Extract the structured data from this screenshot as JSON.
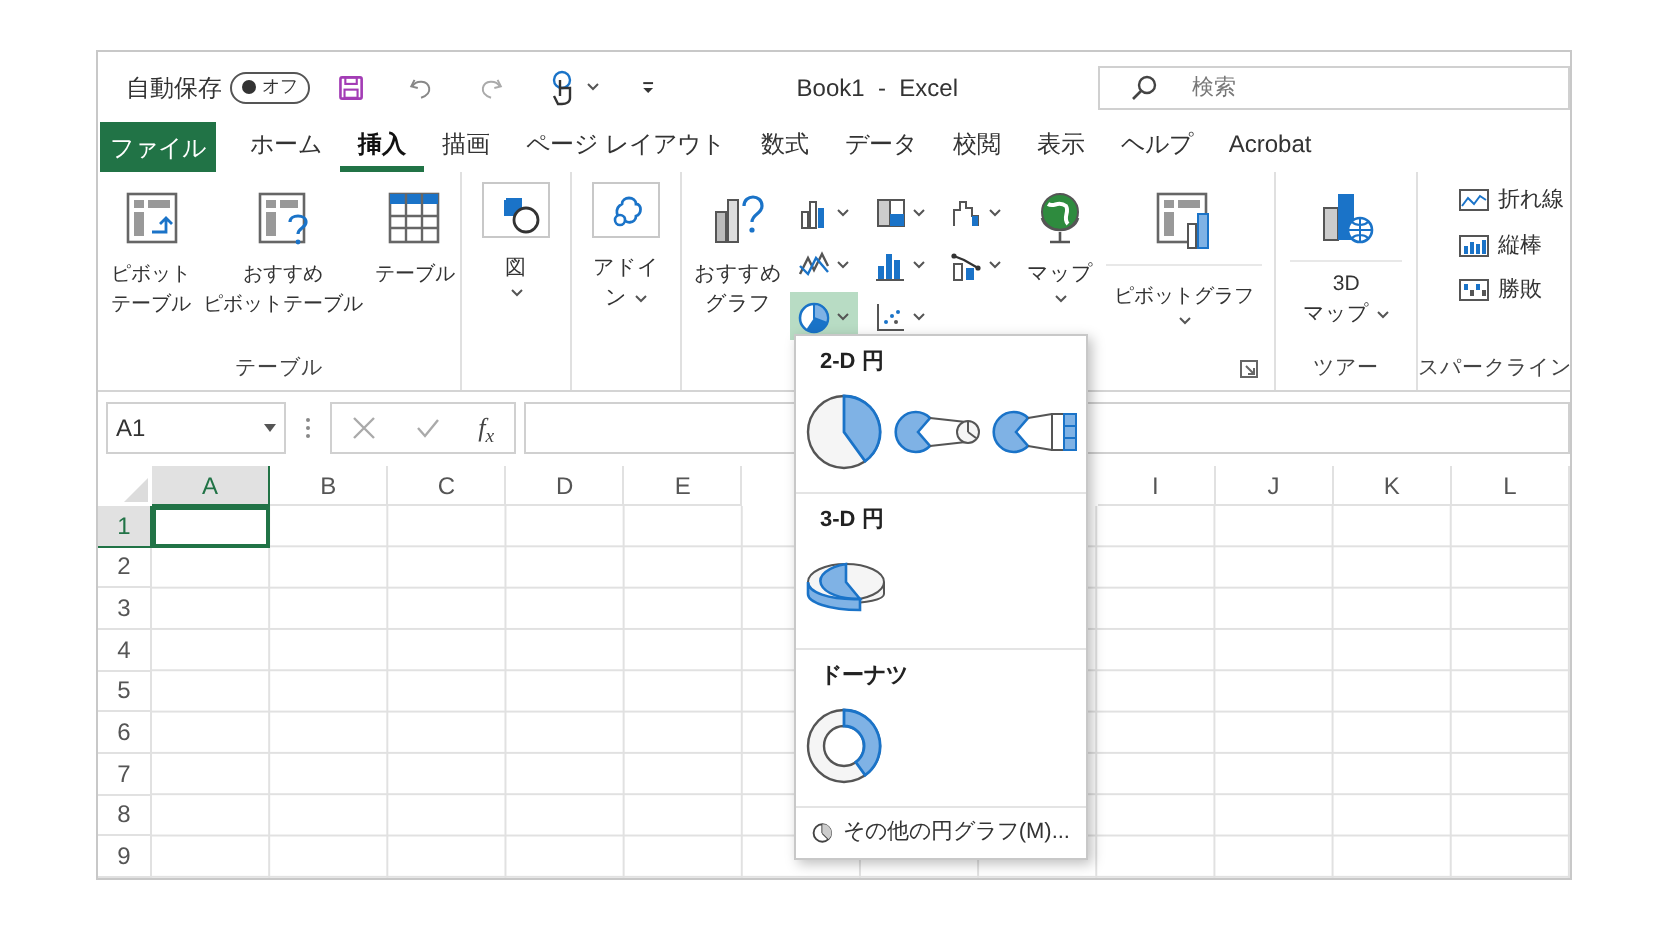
{
  "title_bar": {
    "autosave_label": "自動保存",
    "autosave": {
      "label": "オフ",
      "on": false
    },
    "title": "Book1  -  Excel",
    "search": {
      "placeholder": "検索"
    }
  },
  "tabs": [
    {
      "label": "ファイル",
      "kind": "file",
      "selected": false
    },
    {
      "label": "ホーム",
      "kind": "tab",
      "selected": false
    },
    {
      "label": "挿入",
      "kind": "tab",
      "selected": true
    },
    {
      "label": "描画",
      "kind": "tab",
      "selected": false
    },
    {
      "label": "ページ レイアウト",
      "kind": "tab",
      "selected": false
    },
    {
      "label": "数式",
      "kind": "tab",
      "selected": false
    },
    {
      "label": "データ",
      "kind": "tab",
      "selected": false
    },
    {
      "label": "校閲",
      "kind": "tab",
      "selected": false
    },
    {
      "label": "表示",
      "kind": "tab",
      "selected": false
    },
    {
      "label": "ヘルプ",
      "kind": "tab",
      "selected": false
    },
    {
      "label": "Acrobat",
      "kind": "tab",
      "selected": false
    }
  ],
  "ribbon": {
    "table_group": {
      "label": "テーブル",
      "buttons": [
        {
          "lines": [
            "ピボット",
            "テーブル"
          ]
        },
        {
          "lines": [
            "おすすめ",
            "ピボットテーブル"
          ]
        },
        {
          "lines": [
            "テーブル"
          ]
        }
      ]
    },
    "boxed_buttons": [
      {
        "lines": [
          "図"
        ],
        "has_menu": true
      },
      {
        "lines": [
          "アドイ",
          "ン"
        ],
        "has_menu": true
      }
    ],
    "charts_group": {
      "recommended": {
        "lines": [
          "おすすめ",
          "グラフ"
        ]
      },
      "chart_buttons": [
        {
          "selected": false
        },
        {
          "selected": false
        },
        {
          "selected": false
        },
        {
          "selected": false
        },
        {
          "selected": false
        },
        {
          "selected": false
        },
        {
          "selected": true
        },
        {
          "selected": false
        }
      ],
      "map": {
        "lines": [
          "マップ"
        ],
        "has_menu": true
      },
      "pivot_chart": {
        "lines": [
          "ピボットグラフ"
        ],
        "has_menu": true
      }
    },
    "tour_group": {
      "label": "ツアー",
      "button": {
        "lines": [
          "3D",
          "マップ"
        ],
        "has_menu": true
      }
    },
    "sparkline_group": {
      "label": "スパークライン",
      "items": [
        "折れ線",
        "縦棒",
        "勝敗"
      ]
    }
  },
  "formula_bar": {
    "name_box": "A1",
    "fx": "f$_{x}$"
  },
  "grid": {
    "columns_left": [
      {
        "label": "A",
        "selected": true
      },
      {
        "label": "B",
        "selected": false
      },
      {
        "label": "C",
        "selected": false
      },
      {
        "label": "D",
        "selected": false
      },
      {
        "label": "E",
        "selected": false
      }
    ],
    "columns_right": [
      {
        "label": "I",
        "selected": false
      },
      {
        "label": "J",
        "selected": false
      },
      {
        "label": "K",
        "selected": false
      },
      {
        "label": "L",
        "selected": false
      }
    ],
    "rows": [
      {
        "label": "1",
        "selected": true
      },
      {
        "label": "2",
        "selected": false
      },
      {
        "label": "3",
        "selected": false
      },
      {
        "label": "4",
        "selected": false
      },
      {
        "label": "5",
        "selected": false
      },
      {
        "label": "6",
        "selected": false
      },
      {
        "label": "7",
        "selected": false
      },
      {
        "label": "8",
        "selected": false
      },
      {
        "label": "9",
        "selected": false
      }
    ]
  },
  "pie_menu": {
    "sections": [
      {
        "heading": "2-D 円"
      },
      {
        "heading": "3-D 円"
      },
      {
        "heading": "ドーナツ"
      }
    ],
    "footer": "その他の円グラフ(M)..."
  }
}
